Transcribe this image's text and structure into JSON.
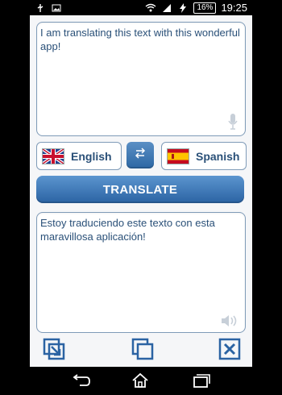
{
  "status_bar": {
    "time": "19:25",
    "battery": "16%",
    "icons": [
      "usb-icon",
      "image-icon",
      "wifi-icon",
      "signal-icon",
      "charging-icon"
    ]
  },
  "input": {
    "text": "I am translating this text with this wonderful app!",
    "mic_icon": "mic-icon"
  },
  "languages": {
    "source": {
      "name": "English",
      "flag": "uk-flag-icon"
    },
    "target": {
      "name": "Spanish",
      "flag": "spain-flag-icon"
    },
    "swap_icon": "swap-icon"
  },
  "translate_button": {
    "label": "TRANSLATE"
  },
  "output": {
    "text": "Estoy traduciendo este texto con esta maravillosa aplicación!",
    "speaker_icon": "speaker-icon"
  },
  "toolbar": {
    "left_icon": "paste-icon",
    "middle_icon": "copy-icon",
    "right_icon": "clear-icon"
  },
  "nav": {
    "icons": [
      "back-icon",
      "home-icon",
      "recent-apps-icon"
    ]
  },
  "colors": {
    "accent": "#2b63a3",
    "text": "#2a5078",
    "border": "#7f9bb8"
  }
}
